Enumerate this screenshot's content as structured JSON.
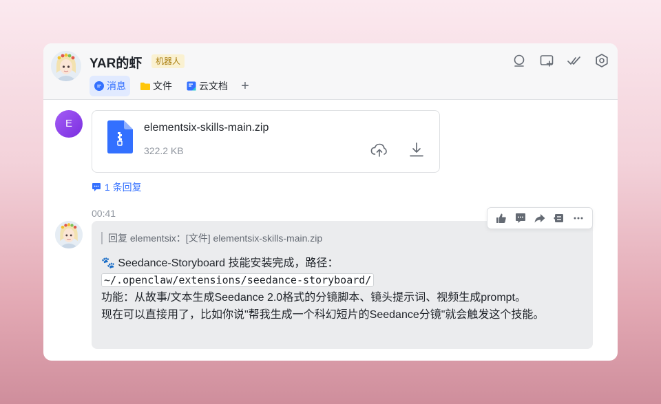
{
  "header": {
    "title": "YAR的虾",
    "badge": "机器人",
    "tabs": [
      {
        "label": "消息",
        "icon": "chat-bubble-icon",
        "active": true
      },
      {
        "label": "文件",
        "icon": "folder-icon",
        "active": false
      },
      {
        "label": "云文档",
        "icon": "doc-icon",
        "active": false
      }
    ],
    "add_tab": "+",
    "actions": [
      "search-icon",
      "add-to-window-icon",
      "mark-done-icon",
      "settings-icon"
    ]
  },
  "messages": {
    "sender_initial": "E",
    "file": {
      "name": "elementsix-skills-main.zip",
      "size": "322.2 KB",
      "actions": [
        "cloud-upload-icon",
        "download-icon"
      ]
    },
    "reply_count": "1 条回复",
    "timestamp": "00:41",
    "reply": {
      "quote": "回复 elementsix：[文件] elementsix-skills-main.zip",
      "paw": "🐾",
      "line1": " Seedance-Storyboard 技能安装完成，路径：",
      "code": "~/.openclaw/extensions/seedance-storyboard/",
      "line2": "功能：从故事/文本生成Seedance 2.0格式的分镜脚本、镜头提示词、视频生成prompt。",
      "line3": "现在可以直接用了，比如你说\"帮我生成一个科幻短片的Seedance分镜\"就会触发这个技能。"
    },
    "hover_actions": [
      "thumbs-up-icon",
      "comment-icon",
      "forward-icon",
      "quote-icon",
      "more-icon"
    ]
  },
  "colors": {
    "accent": "#3370ff",
    "sender_avatar": "#8a3ff0",
    "badge_bg": "#faf1d1",
    "badge_text": "#a87b0a",
    "bubble_bg": "#ebecee"
  }
}
